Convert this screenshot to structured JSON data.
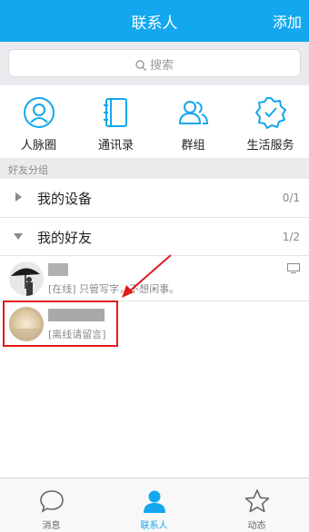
{
  "header": {
    "title": "联系人",
    "action_label": "添加"
  },
  "search": {
    "placeholder": "搜索"
  },
  "quick_actions": [
    {
      "label": "人脉圈",
      "icon": "person-circle-icon"
    },
    {
      "label": "通讯录",
      "icon": "address-book-icon"
    },
    {
      "label": "群组",
      "icon": "group-icon"
    },
    {
      "label": "生活服务",
      "icon": "service-badge-icon"
    }
  ],
  "section_label": "好友分组",
  "groups": [
    {
      "name": "我的设备",
      "count": "0/1",
      "expanded": false
    },
    {
      "name": "我的好友",
      "count": "1/2",
      "expanded": true
    }
  ],
  "friends": [
    {
      "status": "[在线] 只管写字，不想闲事。",
      "online": true,
      "device_icon": "monitor-icon"
    },
    {
      "status": "[离线请留言]",
      "online": false
    }
  ],
  "tabbar": {
    "items": [
      {
        "label": "消息",
        "icon": "chat-bubble-icon",
        "active": false
      },
      {
        "label": "联系人",
        "icon": "contact-person-icon",
        "active": true
      },
      {
        "label": "动态",
        "icon": "star-icon",
        "active": false
      }
    ]
  },
  "colors": {
    "accent": "#12a7ee",
    "highlight": "#e11b1b"
  }
}
